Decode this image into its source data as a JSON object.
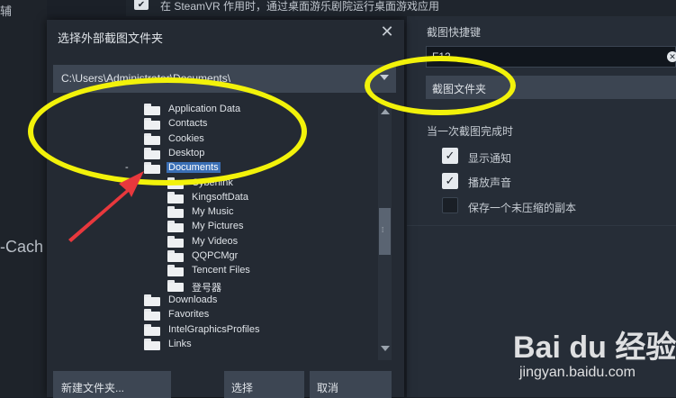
{
  "background": {
    "left_top_text": "辅",
    "left_mid_text": "-Cach"
  },
  "top_bar": {
    "checkbox_mark": "✔",
    "text": "在 SteamVR 作用时，通过桌面游乐剧院运行桌面游戏应用"
  },
  "right_panel": {
    "shortcut_label": "截图快捷键",
    "shortcut_value": "F12",
    "clear_glyph": "✕",
    "external_folder_button": "截图文件夹",
    "on_complete_label": "当一次截图完成时",
    "options": [
      {
        "label": "显示通知",
        "checked": true
      },
      {
        "label": "播放声音",
        "checked": true
      },
      {
        "label": "保存一个未压缩的副本",
        "checked": false
      }
    ]
  },
  "dialog": {
    "title": "选择外部截图文件夹",
    "close_glyph": "✕",
    "path": "C:\\Users\\Administrator\\Documents\\",
    "tree_items": [
      {
        "label": "Application Data",
        "level": 0
      },
      {
        "label": "Contacts",
        "level": 0
      },
      {
        "label": "Cookies",
        "level": 0
      },
      {
        "label": "Desktop",
        "level": 0
      },
      {
        "label": "Documents",
        "level": 0,
        "selected": true,
        "expanded_mark": "-"
      },
      {
        "label": "Cyberlink",
        "level": 1
      },
      {
        "label": "KingsoftData",
        "level": 1
      },
      {
        "label": "My Music",
        "level": 1
      },
      {
        "label": "My Pictures",
        "level": 1
      },
      {
        "label": "My Videos",
        "level": 1
      },
      {
        "label": "QQPCMgr",
        "level": 1
      },
      {
        "label": "Tencent Files",
        "level": 1
      },
      {
        "label": "登号器",
        "level": 1
      },
      {
        "label": "Downloads",
        "level": 0
      },
      {
        "label": "Favorites",
        "level": 0
      },
      {
        "label": "IntelGraphicsProfiles",
        "level": 0
      },
      {
        "label": "Links",
        "level": 0
      }
    ],
    "scroll_grip": "⁞",
    "buttons": {
      "new_folder": "新建文件夹...",
      "select": "选择",
      "cancel": "取消"
    }
  },
  "annotation_colors": {
    "ellipse": "#f2f20a",
    "arrow": "#e8383d"
  },
  "watermark": {
    "logo_text": "Bai du 经验",
    "sub_text": "jingyan.baidu.com"
  }
}
